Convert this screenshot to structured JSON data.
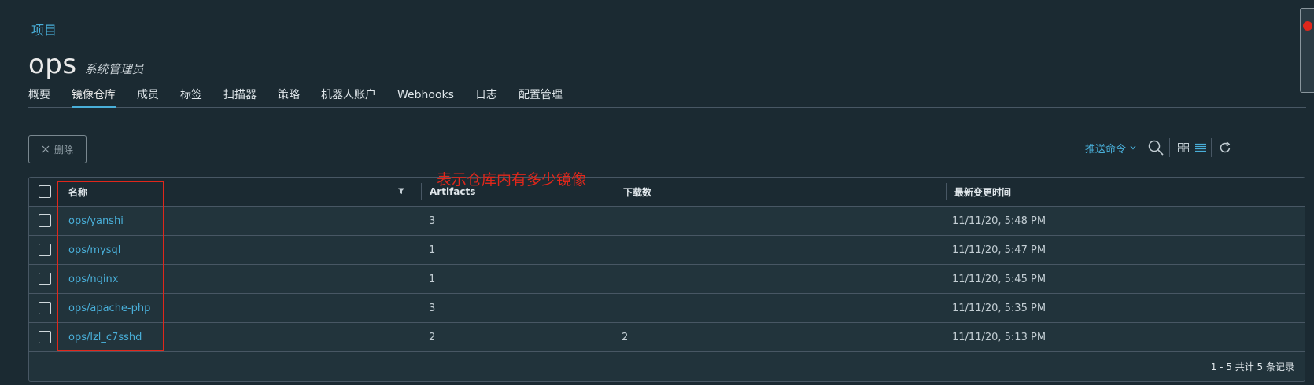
{
  "breadcrumb": "项目",
  "project": {
    "name": "ops",
    "role": "系统管理员"
  },
  "tabs": [
    {
      "label": "概要",
      "active": false
    },
    {
      "label": "镜像仓库",
      "active": true
    },
    {
      "label": "成员",
      "active": false
    },
    {
      "label": "标签",
      "active": false
    },
    {
      "label": "扫描器",
      "active": false
    },
    {
      "label": "策略",
      "active": false
    },
    {
      "label": "机器人账户",
      "active": false
    },
    {
      "label": "Webhooks",
      "active": false
    },
    {
      "label": "日志",
      "active": false
    },
    {
      "label": "配置管理",
      "active": false
    }
  ],
  "toolbar": {
    "delete_label": "删除",
    "push_command_label": "推送命令"
  },
  "annotation": "表示仓库内有多少镜像",
  "table": {
    "columns": [
      "名称",
      "Artifacts",
      "下载数",
      "最新变更时间"
    ],
    "rows": [
      {
        "name": "ops/yanshi",
        "artifacts": "3",
        "downloads": "",
        "updated": "11/11/20, 5:48 PM"
      },
      {
        "name": "ops/mysql",
        "artifacts": "1",
        "downloads": "",
        "updated": "11/11/20, 5:47 PM"
      },
      {
        "name": "ops/nginx",
        "artifacts": "1",
        "downloads": "",
        "updated": "11/11/20, 5:45 PM"
      },
      {
        "name": "ops/apache-php",
        "artifacts": "3",
        "downloads": "",
        "updated": "11/11/20, 5:35 PM"
      },
      {
        "name": "ops/lzl_c7sshd",
        "artifacts": "2",
        "downloads": "2",
        "updated": "11/11/20, 5:13 PM"
      }
    ],
    "footer": "1 - 5 共计 5 条记录"
  },
  "icons": {
    "delete": "close-icon",
    "dropdown": "chevron-down-icon",
    "search": "search-icon",
    "card_view": "grid-view-icon",
    "list_view": "list-view-icon",
    "refresh": "refresh-icon",
    "filter": "filter-icon"
  },
  "colors": {
    "accent": "#49afd9",
    "annotation": "#e0271b",
    "background": "#1b2a32"
  }
}
